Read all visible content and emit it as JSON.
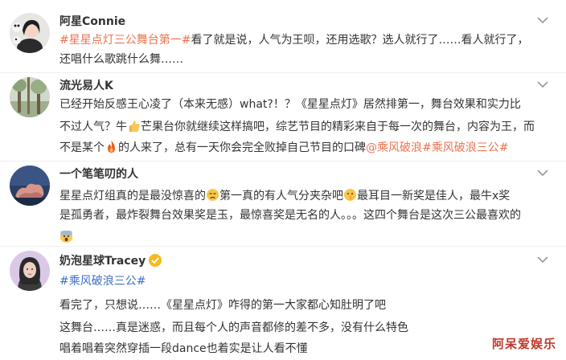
{
  "posts": [
    {
      "username": "阿星Connie",
      "lines": [
        {
          "hashtag": "#星星点灯三公舞台第一#",
          "text": "看了就是说，人气为王呗，还用选歌？选人就行了……看人就行了，"
        },
        {
          "text": "还唱什么歌跳什么舞……"
        }
      ]
    },
    {
      "username": "流光易人K",
      "lines": [
        {
          "text": "已经开始反感王心凌了（本来无感）what?！？《星星点灯》居然排第一，舞台效果和实力比"
        },
        {
          "text_a": "不过人气？牛",
          "text_b": "芒果台你就继续这样搞吧，综艺节目的精彩来自于每一次的舞台，内容为王，而"
        },
        {
          "text_a": "不是某个",
          "text_b": "的人来了，总有一天你会完全败掉自己节目的口碑",
          "mention": "@乘风破浪",
          "hashtag": "#乘风破浪三公#"
        }
      ]
    },
    {
      "username": "一个笔笔叨的人",
      "lines": [
        {
          "text_a": "星星点灯组真的是最没惊喜的",
          "text_b": "第一真的有人气分夹杂吧",
          "text_c": "最耳目一新奖是佳人，最牛x奖"
        },
        {
          "text": "是孤勇者，最炸裂舞台效果奖是玉，最惊喜奖是无名的人。。。这四个舞台是这次三公最喜欢的"
        }
      ]
    },
    {
      "username": "奶泡星球Tracey",
      "lines": [
        {
          "hashtag": "#乘风破浪三公#"
        },
        {
          "text": "看完了，只想说……《星星点灯》咋得的第一大家都心知肚明了吧"
        },
        {
          "text": "这舞台……真是迷惑，而且每个人的声音都修的差不多，没有什么特色"
        },
        {
          "text": "唱着唱着突然穿插一段dance也着实是让人看不懂"
        }
      ]
    }
  ],
  "watermark": "阿呆爱娱乐",
  "colors": {
    "hashtag": "#eb7350",
    "mention": "#eb7350",
    "hashtag_alt": "#3b6fc4",
    "verified": "#f6b91d",
    "watermark": "#c0392b"
  }
}
